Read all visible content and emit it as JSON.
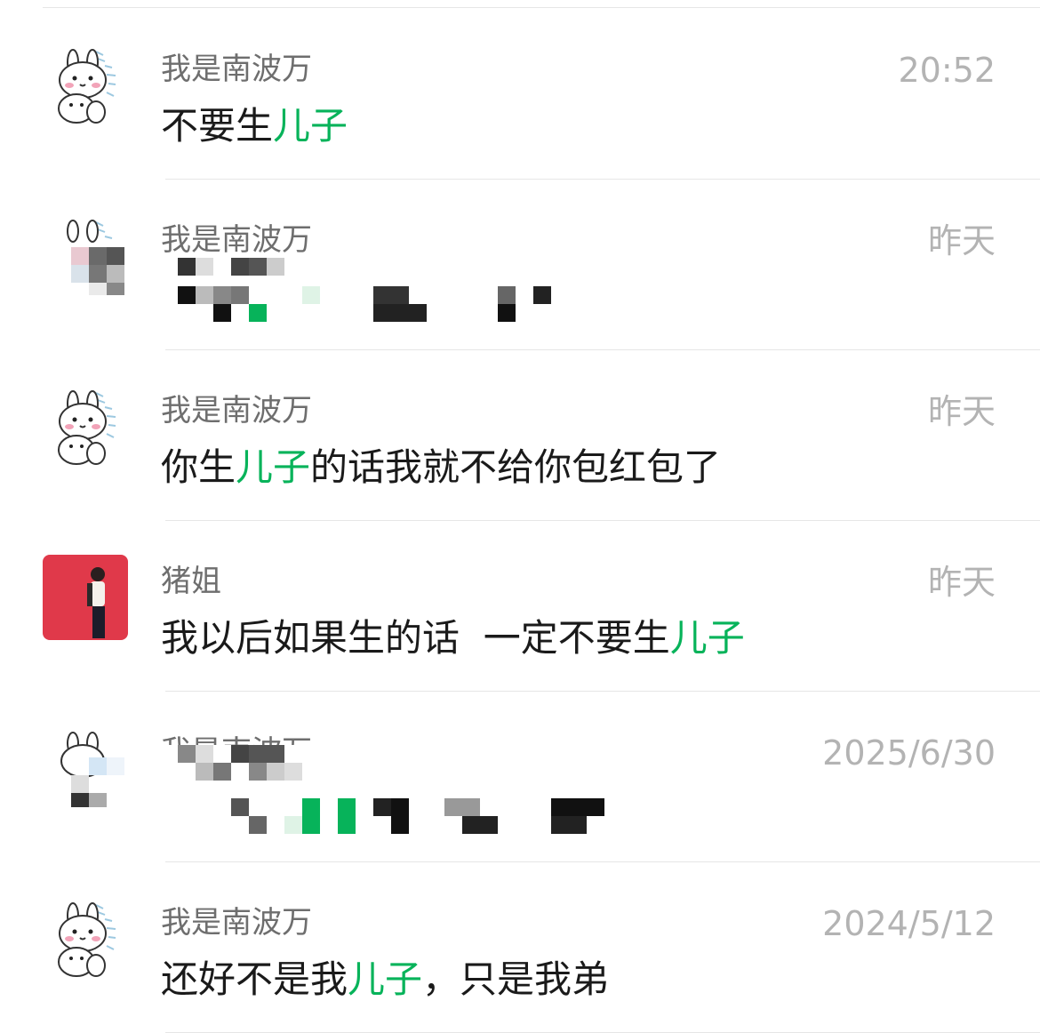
{
  "results": [
    {
      "sender": "我是南波万",
      "time": "20:52",
      "message": {
        "before": "不要生",
        "keyword": "儿子",
        "after": ""
      },
      "avatar": "bunny-sticker",
      "redacted": false
    },
    {
      "sender": "我是南波万",
      "time": "昨天",
      "message": {
        "before": "",
        "keyword": "",
        "after": ""
      },
      "avatar": "bunny-sticker",
      "redacted": true
    },
    {
      "sender": "我是南波万",
      "time": "昨天",
      "message": {
        "before": "你生",
        "keyword": "儿子",
        "after": "的话我就不给你包红包了"
      },
      "avatar": "bunny-sticker",
      "redacted": false
    },
    {
      "sender": "猪姐",
      "time": "昨天",
      "message": {
        "before": "我以后如果生的话  一定不要生",
        "keyword": "儿子",
        "after": ""
      },
      "avatar": "person-photo-red",
      "redacted": false
    },
    {
      "sender": "我是南波万",
      "time": "2025/6/30",
      "message": {
        "before": "",
        "keyword": "",
        "after": ""
      },
      "avatar": "bunny-sticker",
      "redacted": true
    },
    {
      "sender": "我是南波万",
      "time": "2024/5/12",
      "message": {
        "before": "还好不是我",
        "keyword": "儿子",
        "after": "，只是我弟"
      },
      "avatar": "bunny-sticker",
      "redacted": false
    }
  ],
  "colors": {
    "highlight": "#07b35a",
    "sender": "#6e6e6e",
    "time": "#b3b3b3",
    "message": "#1a1a1a",
    "divider": "#e6e6e6",
    "avatar_red": "#e0394a"
  }
}
